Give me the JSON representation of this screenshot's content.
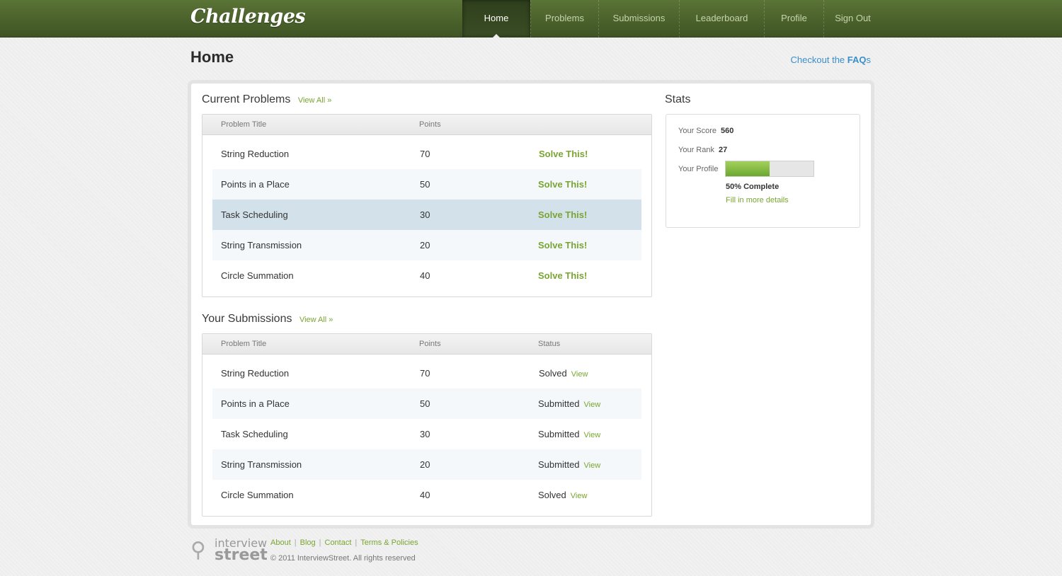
{
  "brand": {
    "logo_text": "Challenges"
  },
  "nav": {
    "items": [
      {
        "label": "Home",
        "active": true
      },
      {
        "label": "Problems",
        "active": false
      },
      {
        "label": "Submissions",
        "active": false
      },
      {
        "label": "Leaderboard",
        "active": false
      },
      {
        "label": "Profile",
        "active": false
      },
      {
        "label": "Sign Out",
        "active": false
      }
    ]
  },
  "page": {
    "title": "Home",
    "faq_prefix": "Checkout the ",
    "faq_strong": "FAQ",
    "faq_suffix": "s"
  },
  "current_problems": {
    "title": "Current Problems",
    "view_all": "View All »",
    "headers": {
      "title": "Problem Title",
      "points": "Points"
    },
    "action_label": "Solve This!",
    "rows": [
      {
        "title": "String Reduction",
        "points": "70"
      },
      {
        "title": "Points  in a Place",
        "points": "50"
      },
      {
        "title": "Task Scheduling",
        "points": "30"
      },
      {
        "title": "String Transmission",
        "points": "20"
      },
      {
        "title": "Circle Summation",
        "points": "40"
      }
    ]
  },
  "submissions": {
    "title": "Your Submissions",
    "view_all": "View All »",
    "headers": {
      "title": "Problem Title",
      "points": "Points",
      "status": "Status"
    },
    "view_label": "View",
    "rows": [
      {
        "title": "String Reduction",
        "points": "70",
        "status": "Solved"
      },
      {
        "title": "Points  in a Place",
        "points": "50",
        "status": "Submitted"
      },
      {
        "title": "Task Scheduling",
        "points": "30",
        "status": "Submitted"
      },
      {
        "title": "String Transmission",
        "points": "20",
        "status": "Submitted"
      },
      {
        "title": "Circle Summation",
        "points": "40",
        "status": "Solved"
      }
    ]
  },
  "stats": {
    "title": "Stats",
    "score_label": "Your Score",
    "score_value": "560",
    "rank_label": "Your Rank",
    "rank_value": "27",
    "profile_label": "Your Profile",
    "profile_percent": 0.5,
    "profile_complete_text": "50% Complete",
    "fill_more": "Fill in more details"
  },
  "footer": {
    "logo_line1": "interview",
    "logo_line2": "street",
    "links": [
      "About",
      "Blog",
      "Contact",
      "Terms & Policies"
    ],
    "copyright": "© 2011 InterviewStreet. All rights reserved"
  },
  "colors": {
    "header_green": "#4a6230",
    "accent_green": "#7aa432",
    "link_blue": "#3a8fc9",
    "highlight_row": "#d3e2ea"
  }
}
